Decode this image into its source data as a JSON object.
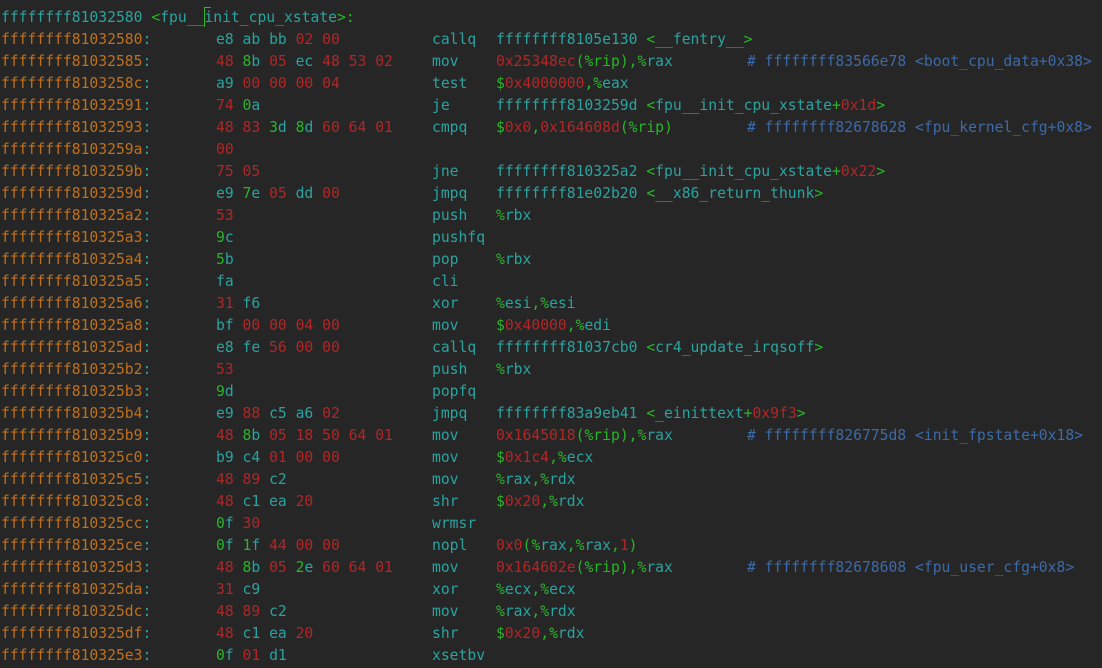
{
  "colors": {
    "background": "#262626",
    "teal": "#2aa3a0",
    "red": "#b22626",
    "green": "#29b529",
    "orange": "#c0701c",
    "comment_blue": "#3d6aa8"
  },
  "header": {
    "address": "ffffffff81032580",
    "symbol": "fpu__init_cpu_xstate"
  },
  "lines": [
    {
      "address": "ffffffff81032580",
      "bytes": "e8 ab bb 02 00",
      "mnemonic": "callq",
      "operands": "ffffffff8105e130 <__fentry__>",
      "comment": ""
    },
    {
      "address": "ffffffff81032585",
      "bytes": "48 8b 05 ec 48 53 02",
      "mnemonic": "mov",
      "operands": "0x25348ec(%rip),%rax",
      "comment": "# ffffffff83566e78 <boot_cpu_data+0x38>"
    },
    {
      "address": "ffffffff8103258c",
      "bytes": "a9 00 00 00 04",
      "mnemonic": "test",
      "operands": "$0x4000000,%eax",
      "comment": ""
    },
    {
      "address": "ffffffff81032591",
      "bytes": "74 0a",
      "mnemonic": "je",
      "operands": "ffffffff8103259d <fpu__init_cpu_xstate+0x1d>",
      "comment": ""
    },
    {
      "address": "ffffffff81032593",
      "bytes": "48 83 3d 8d 60 64 01",
      "mnemonic": "cmpq",
      "operands": "$0x0,0x164608d(%rip)",
      "comment": "# ffffffff82678628 <fpu_kernel_cfg+0x8>"
    },
    {
      "address": "ffffffff8103259a",
      "bytes": "00",
      "mnemonic": "",
      "operands": "",
      "comment": ""
    },
    {
      "address": "ffffffff8103259b",
      "bytes": "75 05",
      "mnemonic": "jne",
      "operands": "ffffffff810325a2 <fpu__init_cpu_xstate+0x22>",
      "comment": ""
    },
    {
      "address": "ffffffff8103259d",
      "bytes": "e9 7e 05 dd 00",
      "mnemonic": "jmpq",
      "operands": "ffffffff81e02b20 <__x86_return_thunk>",
      "comment": ""
    },
    {
      "address": "ffffffff810325a2",
      "bytes": "53",
      "mnemonic": "push",
      "operands": "%rbx",
      "comment": ""
    },
    {
      "address": "ffffffff810325a3",
      "bytes": "9c",
      "mnemonic": "pushfq",
      "operands": "",
      "comment": ""
    },
    {
      "address": "ffffffff810325a4",
      "bytes": "5b",
      "mnemonic": "pop",
      "operands": "%rbx",
      "comment": ""
    },
    {
      "address": "ffffffff810325a5",
      "bytes": "fa",
      "mnemonic": "cli",
      "operands": "",
      "comment": ""
    },
    {
      "address": "ffffffff810325a6",
      "bytes": "31 f6",
      "mnemonic": "xor",
      "operands": "%esi,%esi",
      "comment": ""
    },
    {
      "address": "ffffffff810325a8",
      "bytes": "bf 00 00 04 00",
      "mnemonic": "mov",
      "operands": "$0x40000,%edi",
      "comment": ""
    },
    {
      "address": "ffffffff810325ad",
      "bytes": "e8 fe 56 00 00",
      "mnemonic": "callq",
      "operands": "ffffffff81037cb0 <cr4_update_irqsoff>",
      "comment": ""
    },
    {
      "address": "ffffffff810325b2",
      "bytes": "53",
      "mnemonic": "push",
      "operands": "%rbx",
      "comment": ""
    },
    {
      "address": "ffffffff810325b3",
      "bytes": "9d",
      "mnemonic": "popfq",
      "operands": "",
      "comment": ""
    },
    {
      "address": "ffffffff810325b4",
      "bytes": "e9 88 c5 a6 02",
      "mnemonic": "jmpq",
      "operands": "ffffffff83a9eb41 <_einittext+0x9f3>",
      "comment": ""
    },
    {
      "address": "ffffffff810325b9",
      "bytes": "48 8b 05 18 50 64 01",
      "mnemonic": "mov",
      "operands": "0x1645018(%rip),%rax",
      "comment": "# ffffffff826775d8 <init_fpstate+0x18>"
    },
    {
      "address": "ffffffff810325c0",
      "bytes": "b9 c4 01 00 00",
      "mnemonic": "mov",
      "operands": "$0x1c4,%ecx",
      "comment": ""
    },
    {
      "address": "ffffffff810325c5",
      "bytes": "48 89 c2",
      "mnemonic": "mov",
      "operands": "%rax,%rdx",
      "comment": ""
    },
    {
      "address": "ffffffff810325c8",
      "bytes": "48 c1 ea 20",
      "mnemonic": "shr",
      "operands": "$0x20,%rdx",
      "comment": ""
    },
    {
      "address": "ffffffff810325cc",
      "bytes": "0f 30",
      "mnemonic": "wrmsr",
      "operands": "",
      "comment": ""
    },
    {
      "address": "ffffffff810325ce",
      "bytes": "0f 1f 44 00 00",
      "mnemonic": "nopl",
      "operands": "0x0(%rax,%rax,1)",
      "comment": ""
    },
    {
      "address": "ffffffff810325d3",
      "bytes": "48 8b 05 2e 60 64 01",
      "mnemonic": "mov",
      "operands": "0x164602e(%rip),%rax",
      "comment": "# ffffffff82678608 <fpu_user_cfg+0x8>"
    },
    {
      "address": "ffffffff810325da",
      "bytes": "31 c9",
      "mnemonic": "xor",
      "operands": "%ecx,%ecx",
      "comment": ""
    },
    {
      "address": "ffffffff810325dc",
      "bytes": "48 89 c2",
      "mnemonic": "mov",
      "operands": "%rax,%rdx",
      "comment": ""
    },
    {
      "address": "ffffffff810325df",
      "bytes": "48 c1 ea 20",
      "mnemonic": "shr",
      "operands": "$0x20,%rdx",
      "comment": ""
    },
    {
      "address": "ffffffff810325e3",
      "bytes": "0f 01 d1",
      "mnemonic": "xsetbv",
      "operands": "",
      "comment": ""
    }
  ]
}
